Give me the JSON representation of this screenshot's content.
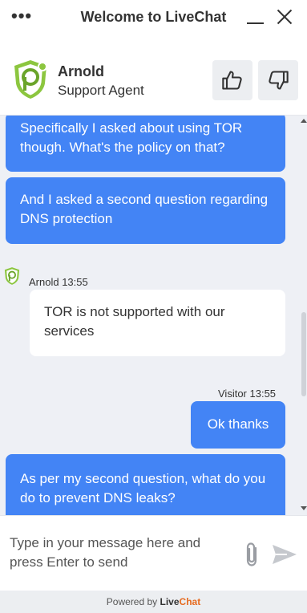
{
  "window": {
    "title": "Welcome to LiveChat",
    "menu_icon": "more-dots-icon",
    "minimize_icon": "minimize-icon",
    "close_icon": "close-icon"
  },
  "agent": {
    "name": "Arnold",
    "role": "Support Agent",
    "avatar_icon": "pureVPN-shield-logo",
    "rate_up_icon": "thumbs-up-icon",
    "rate_down_icon": "thumbs-down-icon"
  },
  "messages": [
    {
      "author": "visitor",
      "text": "Specifically I asked about using TOR though. What's the policy on that?"
    },
    {
      "author": "visitor",
      "text": "And I asked a second question regarding DNS protection"
    },
    {
      "author": "agent",
      "meta": "Arnold 13:55",
      "text": "TOR is not supported with our services"
    },
    {
      "author": "visitor",
      "meta": "Visitor 13:55",
      "text": "Ok thanks"
    },
    {
      "author": "visitor",
      "text": "As per my second question, what do you do to prevent DNS leaks?"
    }
  ],
  "composer": {
    "placeholder": "Type in your message here and press Enter to send",
    "attach_icon": "paperclip-icon",
    "send_icon": "send-icon"
  },
  "footer": {
    "powered_by": "Powered by",
    "brand_live": "Live",
    "brand_chat": "Chat"
  },
  "colors": {
    "visitor_bubble": "#4384f5",
    "agent_bubble": "#ffffff",
    "chat_background": "#eef0f5",
    "brand_accent": "#e66a1e",
    "logo_green": "#8cc63f"
  }
}
